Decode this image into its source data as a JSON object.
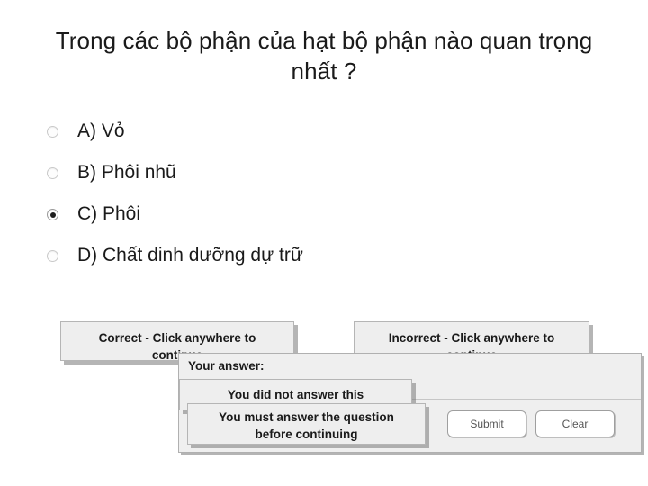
{
  "slide": {
    "background_color": "#ffffff",
    "question": "Trong các bộ phận của hạt bộ phận nào quan trọng nhất ?"
  },
  "choices": [
    {
      "id": "choice-a",
      "label": "A) Vỏ",
      "selected": false
    },
    {
      "id": "choice-b",
      "label": "B) Phôi nhũ",
      "selected": false
    },
    {
      "id": "choice-c",
      "label": "C) Phôi",
      "selected": true
    },
    {
      "id": "choice-d",
      "label": "D) Chất dinh dưỡng dự trữ",
      "selected": false
    }
  ],
  "feedback": {
    "correct": {
      "line1": "Correct - Click anywhere to",
      "line2": "continue"
    },
    "incorrect": {
      "line1": "Incorrect - Click anywhere to",
      "line2": "continue"
    },
    "not_answered": {
      "line1": "You did not answer this"
    },
    "must_answer": {
      "line1": "You must answer the question",
      "line2": "before continuing"
    }
  },
  "answer_panel": {
    "your_answer_label": "Your answer:",
    "submit_label": "Submit",
    "clear_label": "Clear"
  },
  "colors": {
    "panel_face": "#eeeeee",
    "panel_border": "#b5b5b5",
    "panel_shadow": "#787878",
    "button_face": "#ffffff",
    "button_border": "#9f9f9f",
    "text": "#1a1a1a",
    "radio_ring": "#c9c9c9",
    "radio_dot": "#1c1c1c"
  }
}
